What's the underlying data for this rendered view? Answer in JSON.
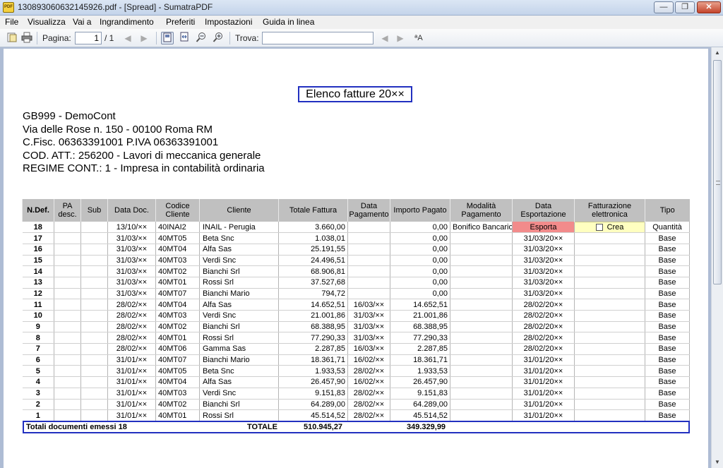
{
  "window": {
    "title": "130893060632145926.pdf - [Spread] - SumatraPDF",
    "icon_text": "PDF",
    "minimize": "—",
    "maximize": "❐",
    "close": "✕"
  },
  "menu": [
    "File",
    "Visualizza",
    "Vai a",
    "Ingrandimento",
    "Preferiti",
    "Impostazioni",
    "Guida in linea"
  ],
  "toolbar": {
    "page_label": "Pagina:",
    "page_value": "1",
    "page_total": "/ 1",
    "find_label": "Trova:",
    "find_value": ""
  },
  "document": {
    "title": "Elenco fatture 20××",
    "company_lines": [
      "GB999 - DemoCont",
      "Via delle Rose n. 150 - 00100 Roma RM",
      "C.Fisc. 06363391001  P.IVA 06363391001",
      "COD. ATT.: 256200 - Lavori di meccanica generale",
      "REGIME CONT.: 1 - Impresa  in contabilità ordinaria"
    ],
    "columns": [
      "N.Def.",
      "PA desc.",
      "Sub",
      "Data Doc.",
      "Codice Cliente",
      "Cliente",
      "Totale Fattura",
      "Data Pagamento",
      "Importo Pagato",
      "Modalità Pagamento",
      "Data Esportazione",
      "Fatturazione elettronica",
      "Tipo"
    ],
    "rows": [
      [
        "18",
        "",
        "",
        "13/10/××",
        "40INAI2",
        "INAIL - Perugia",
        "3.660,00",
        "",
        "0,00",
        "Bonifico Bancario",
        "Esporta",
        "Crea",
        "Quantità"
      ],
      [
        "17",
        "",
        "",
        "31/03/××",
        "40MT05",
        "Beta Snc",
        "1.038,01",
        "",
        "0,00",
        "",
        "31/03/20××",
        "",
        "Base"
      ],
      [
        "16",
        "",
        "",
        "31/03/××",
        "40MT04",
        "Alfa Sas",
        "25.191,55",
        "",
        "0,00",
        "",
        "31/03/20××",
        "",
        "Base"
      ],
      [
        "15",
        "",
        "",
        "31/03/××",
        "40MT03",
        "Verdi Snc",
        "24.496,51",
        "",
        "0,00",
        "",
        "31/03/20××",
        "",
        "Base"
      ],
      [
        "14",
        "",
        "",
        "31/03/××",
        "40MT02",
        "Bianchi Srl",
        "68.906,81",
        "",
        "0,00",
        "",
        "31/03/20××",
        "",
        "Base"
      ],
      [
        "13",
        "",
        "",
        "31/03/××",
        "40MT01",
        "Rossi Srl",
        "37.527,68",
        "",
        "0,00",
        "",
        "31/03/20××",
        "",
        "Base"
      ],
      [
        "12",
        "",
        "",
        "31/03/××",
        "40MT07",
        "Bianchi Mario",
        "794,72",
        "",
        "0,00",
        "",
        "31/03/20××",
        "",
        "Base"
      ],
      [
        "11",
        "",
        "",
        "28/02/××",
        "40MT04",
        "Alfa Sas",
        "14.652,51",
        "16/03/××",
        "14.652,51",
        "",
        "28/02/20××",
        "",
        "Base"
      ],
      [
        "10",
        "",
        "",
        "28/02/××",
        "40MT03",
        "Verdi Snc",
        "21.001,86",
        "31/03/××",
        "21.001,86",
        "",
        "28/02/20××",
        "",
        "Base"
      ],
      [
        "9",
        "",
        "",
        "28/02/××",
        "40MT02",
        "Bianchi Srl",
        "68.388,95",
        "31/03/××",
        "68.388,95",
        "",
        "28/02/20××",
        "",
        "Base"
      ],
      [
        "8",
        "",
        "",
        "28/02/××",
        "40MT01",
        "Rossi Srl",
        "77.290,33",
        "31/03/××",
        "77.290,33",
        "",
        "28/02/20××",
        "",
        "Base"
      ],
      [
        "7",
        "",
        "",
        "28/02/××",
        "40MT06",
        "Gamma Sas",
        "2.287,85",
        "16/03/××",
        "2.287,85",
        "",
        "28/02/20××",
        "",
        "Base"
      ],
      [
        "6",
        "",
        "",
        "31/01/××",
        "40MT07",
        "Bianchi Mario",
        "18.361,71",
        "16/02/××",
        "18.361,71",
        "",
        "31/01/20××",
        "",
        "Base"
      ],
      [
        "5",
        "",
        "",
        "31/01/××",
        "40MT05",
        "Beta Snc",
        "1.933,53",
        "28/02/××",
        "1.933,53",
        "",
        "31/01/20××",
        "",
        "Base"
      ],
      [
        "4",
        "",
        "",
        "31/01/××",
        "40MT04",
        "Alfa Sas",
        "26.457,90",
        "16/02/××",
        "26.457,90",
        "",
        "31/01/20××",
        "",
        "Base"
      ],
      [
        "3",
        "",
        "",
        "31/01/××",
        "40MT03",
        "Verdi Snc",
        "9.151,83",
        "28/02/××",
        "9.151,83",
        "",
        "31/01/20××",
        "",
        "Base"
      ],
      [
        "2",
        "",
        "",
        "31/01/××",
        "40MT02",
        "Bianchi Srl",
        "64.289,00",
        "28/02/××",
        "64.289,00",
        "",
        "31/01/20××",
        "",
        "Base"
      ],
      [
        "1",
        "",
        "",
        "31/01/××",
        "40MT01",
        "Rossi Srl",
        "45.514,52",
        "28/02/××",
        "45.514,52",
        "",
        "31/01/20××",
        "",
        "Base"
      ]
    ],
    "totals": {
      "label": "Totali documenti emessi 18",
      "totale_label": "TOTALE",
      "totale_fattura": "510.945,27",
      "importo_pagato": "349.329,99"
    }
  }
}
